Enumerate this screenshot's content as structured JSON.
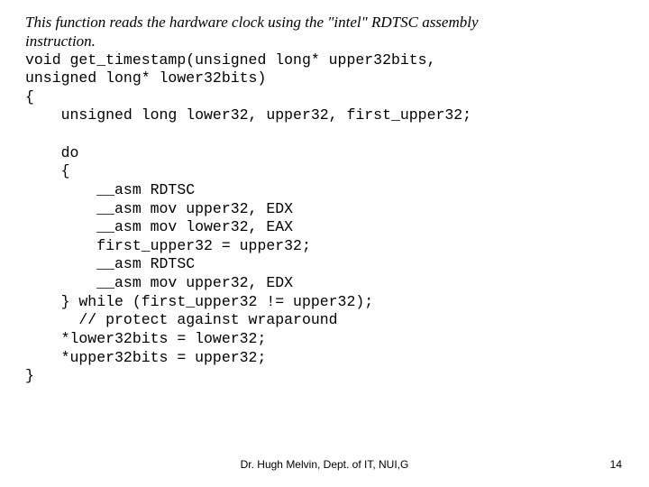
{
  "comment_line1": "This function reads the hardware clock using the \"intel\" RDTSC assembly",
  "comment_line2": "instruction.",
  "code": "void get_timestamp(unsigned long* upper32bits,\nunsigned long* lower32bits)\n{\n    unsigned long lower32, upper32, first_upper32;\n\n    do\n    {\n        __asm RDTSC\n        __asm mov upper32, EDX\n        __asm mov lower32, EAX\n        first_upper32 = upper32;\n        __asm RDTSC\n        __asm mov upper32, EDX\n    } while (first_upper32 != upper32);\n      // protect against wraparound\n    *lower32bits = lower32;\n    *upper32bits = upper32;\n}",
  "footer": "Dr. Hugh Melvin, Dept. of IT, NUI,G",
  "pagenum": "14"
}
